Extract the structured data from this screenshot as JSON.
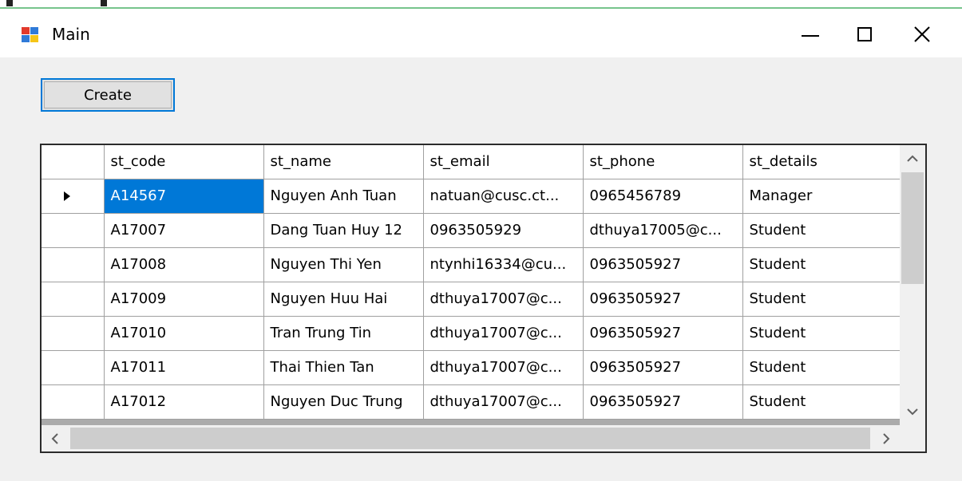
{
  "window": {
    "title": "Main",
    "minimize_icon": "minimize-icon",
    "maximize_icon": "maximize-icon",
    "close_icon": "close-icon",
    "close_glyph": "✕"
  },
  "toolbar": {
    "create_label": "Create"
  },
  "grid": {
    "columns": [
      "st_code",
      "st_name",
      "st_email",
      "st_phone",
      "st_details"
    ],
    "rows": [
      [
        "A14567",
        "Nguyen Anh Tuan",
        "natuan@cusc.ct...",
        "0965456789",
        "Manager"
      ],
      [
        "A17007",
        "Dang Tuan Huy 12",
        "0963505929",
        "dthuya17005@c...",
        "Student"
      ],
      [
        "A17008",
        "Nguyen Thi Yen",
        "ntynhi16334@cu...",
        "0963505927",
        "Student"
      ],
      [
        "A17009",
        "Nguyen Huu Hai",
        "dthuya17007@c...",
        "0963505927",
        "Student"
      ],
      [
        "A17010",
        "Tran Trung Tin",
        "dthuya17007@c...",
        "0963505927",
        "Student"
      ],
      [
        "A17011",
        "Thai Thien Tan",
        "dthuya17007@c...",
        "0963505927",
        "Student"
      ],
      [
        "A17012",
        "Nguyen Duc Trung",
        "dthuya17007@c...",
        "0963505927",
        "Student"
      ]
    ],
    "selected_row": 0,
    "selected_col": 0
  },
  "scrollbars": {
    "up_glyph": "︿",
    "down_glyph": "﹀",
    "left_glyph": "‹",
    "right_glyph": "›"
  },
  "colors": {
    "accent": "#0078d7",
    "selection_text": "#ffffff"
  }
}
